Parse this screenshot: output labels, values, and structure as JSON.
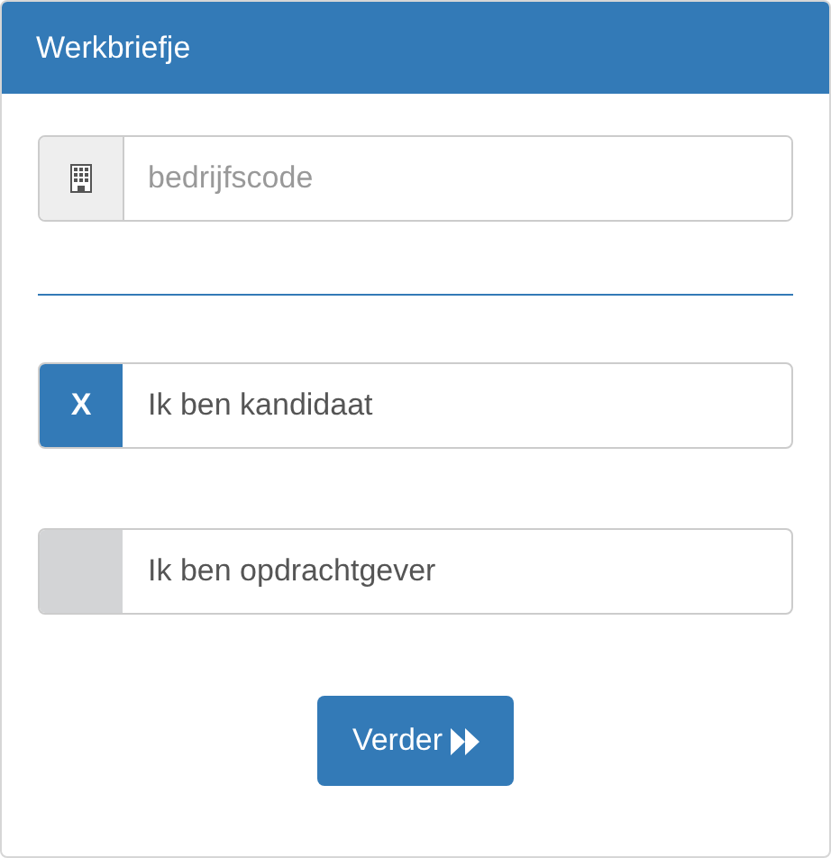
{
  "panel": {
    "title": "Werkbriefje"
  },
  "company_field": {
    "placeholder": "bedrijfscode"
  },
  "roles": [
    {
      "label": "Ik ben kandidaat",
      "selected": true,
      "check_mark": "X"
    },
    {
      "label": "Ik ben opdrachtgever",
      "selected": false
    }
  ],
  "button": {
    "label": "Verder"
  }
}
